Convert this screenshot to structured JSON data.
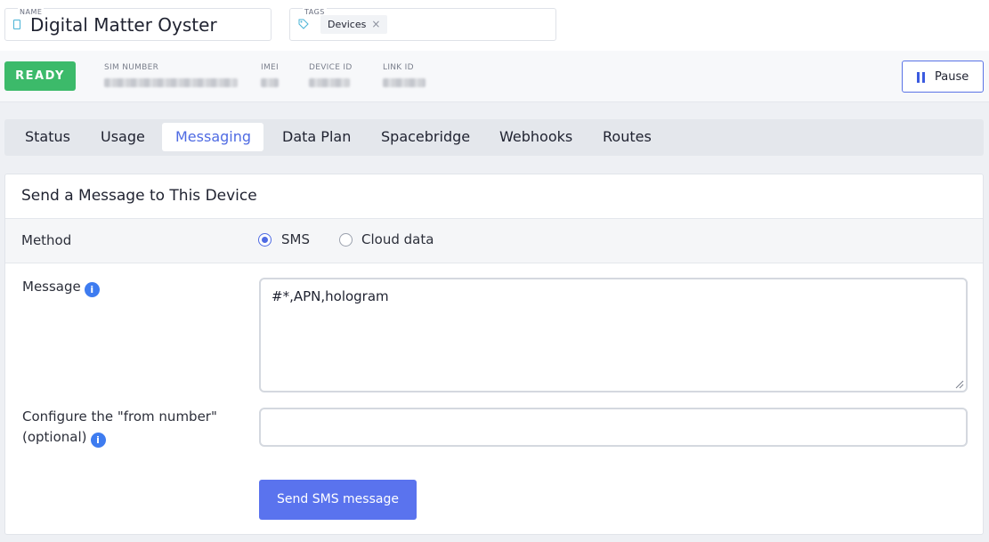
{
  "header": {
    "name_caption": "NAME",
    "device_name": "Digital Matter Oyster",
    "tags_caption": "TAGS",
    "tags": [
      "Devices"
    ],
    "tag_remove_glyph": "×"
  },
  "info": {
    "status": "READY",
    "status_color": "#3cba6a",
    "fields": [
      {
        "label": "SIM NUMBER"
      },
      {
        "label": "IMEI"
      },
      {
        "label": "DEVICE ID"
      },
      {
        "label": "LINK ID"
      }
    ],
    "pause_label": "Pause"
  },
  "tabs": [
    {
      "label": "Status",
      "active": false
    },
    {
      "label": "Usage",
      "active": false
    },
    {
      "label": "Messaging",
      "active": true
    },
    {
      "label": "Data Plan",
      "active": false
    },
    {
      "label": "Spacebridge",
      "active": false
    },
    {
      "label": "Webhooks",
      "active": false
    },
    {
      "label": "Routes",
      "active": false
    }
  ],
  "card": {
    "title": "Send a Message to This Device",
    "method_label": "Method",
    "methods": [
      {
        "label": "SMS",
        "selected": true
      },
      {
        "label": "Cloud data",
        "selected": false
      }
    ],
    "message_label": "Message",
    "message_value": "#*,APN,hologram",
    "from_label_line1": "Configure the \"from number\"",
    "from_label_line2": "(optional)",
    "from_value": "",
    "send_label": "Send SMS message"
  },
  "colors": {
    "accent": "#4f6be3",
    "button": "#5a73ee",
    "info_icon": "#3e7cf0"
  },
  "icons": {
    "name_icon": "sim-card-icon",
    "tag_icon": "tag-icon",
    "info_icon": "info-icon",
    "pause_icon": "pause-icon"
  }
}
